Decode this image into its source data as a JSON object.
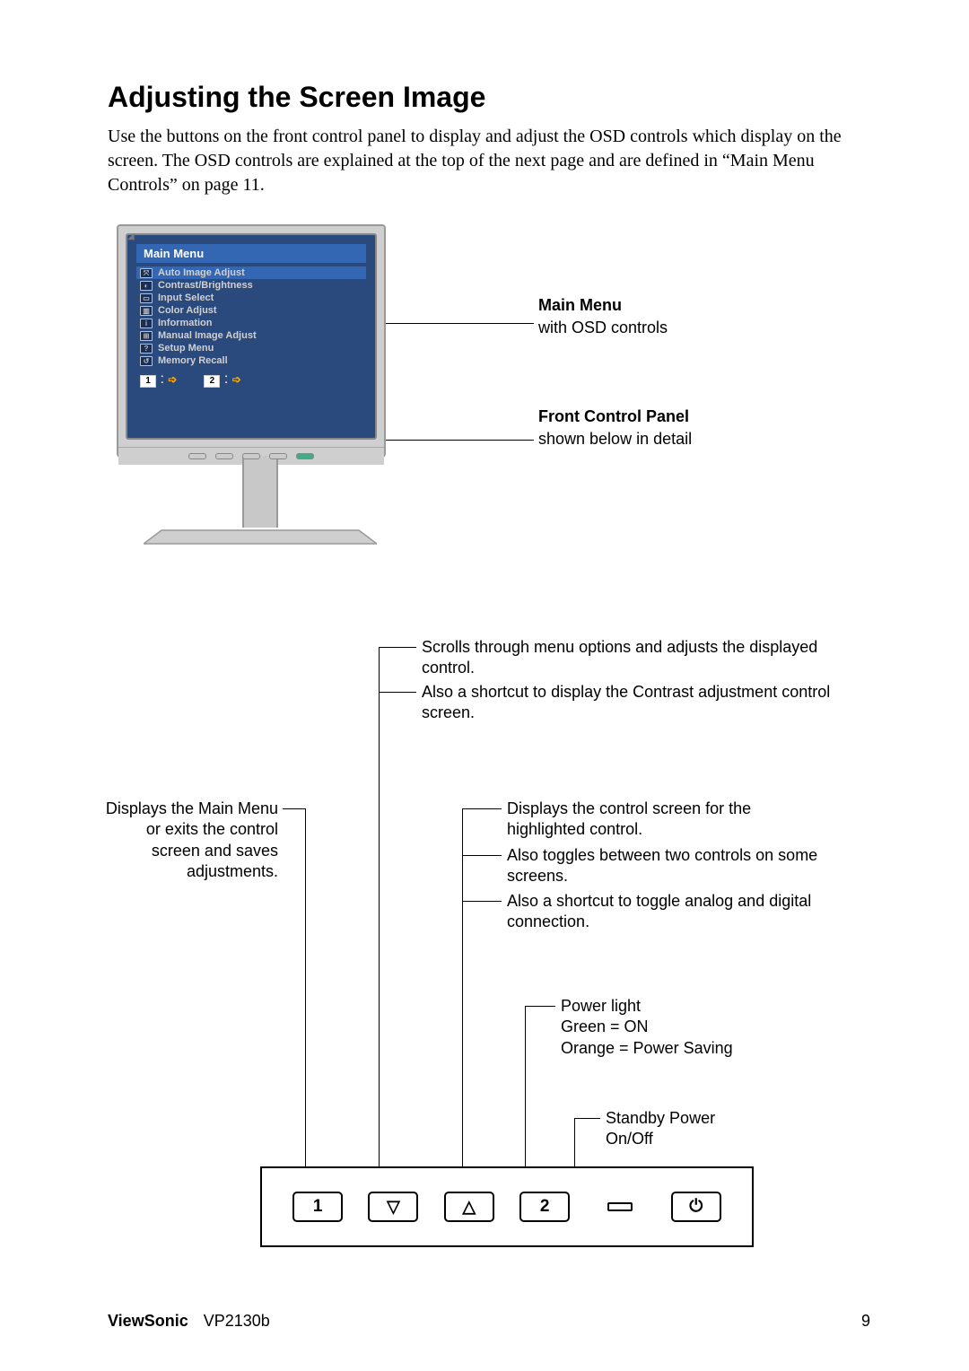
{
  "page": {
    "title": "Adjusting the Screen Image",
    "intro": "Use the buttons on the front control panel to display and adjust the OSD controls which display on the screen. The OSD controls are explained at the top of the next page and are defined in “Main Menu Controls” on page 11."
  },
  "osd": {
    "main_menu_title": "Main Menu",
    "items": [
      "Auto Image Adjust",
      "Contrast/Brightness",
      "Input Select",
      "Color Adjust",
      "Information",
      "Manual Image Adjust",
      "Setup Menu",
      "Memory Recall"
    ],
    "footer_key1": "1",
    "footer_key2": "2",
    "footer_sep": ":"
  },
  "monitor_labels": {
    "main_menu_head": "Main Menu",
    "main_menu_sub": "with OSD controls",
    "front_panel_head": "Front Control Panel",
    "front_panel_sub": "shown below in detail"
  },
  "diagram": {
    "left_caption": "Displays the Main Menu or exits the control screen and saves adjustments.",
    "up_caption_1": "Scrolls through menu options and adjusts the displayed control.",
    "up_caption_2": "Also a shortcut to display the Contrast adjustment control screen.",
    "btn2_caption_1": "Displays the control screen for the highlighted control.",
    "btn2_caption_2": "Also toggles between two controls on some screens.",
    "btn2_caption_3": "Also a shortcut to toggle analog and digital connection.",
    "power_light_caption": "Power light",
    "power_light_green": "Green = ON",
    "power_light_orange": "Orange = Power Saving",
    "standby_caption_1": "Standby Power",
    "standby_caption_2": "On/Off"
  },
  "buttons": {
    "btn1": "1",
    "btn_down": "▽",
    "btn_up": "△",
    "btn2": "2",
    "btn_power": "⏻"
  },
  "footer": {
    "brand": "ViewSonic",
    "model": "VP2130b",
    "page_no": "9"
  }
}
